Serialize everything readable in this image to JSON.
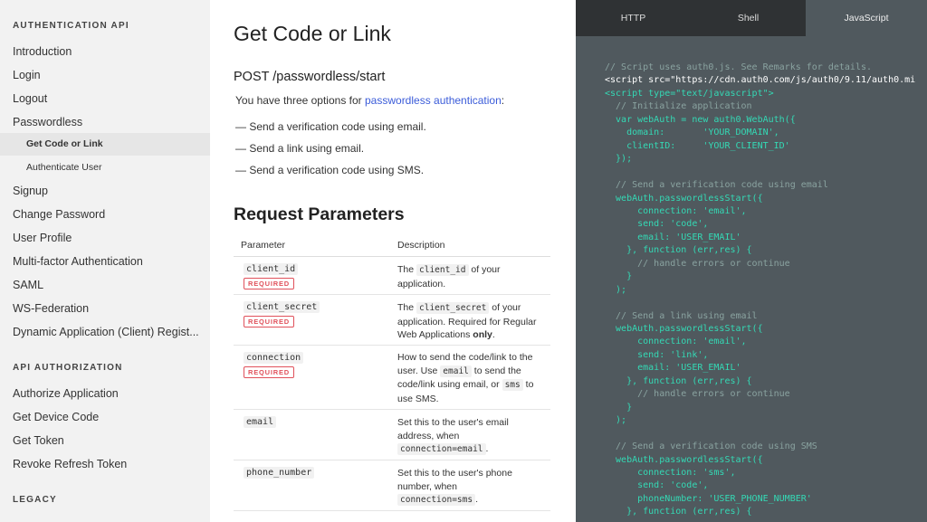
{
  "sidebar": {
    "section_auth": "AUTHENTICATION API",
    "items_auth": [
      "Introduction",
      "Login",
      "Logout",
      "Passwordless"
    ],
    "sub_items": [
      "Get Code or Link",
      "Authenticate User"
    ],
    "items_auth2": [
      "Signup",
      "Change Password",
      "User Profile",
      "Multi-factor Authentication",
      "SAML",
      "WS-Federation",
      "Dynamic Application (Client) Regist..."
    ],
    "section_authz": "API AUTHORIZATION",
    "items_authz": [
      "Authorize Application",
      "Get Device Code",
      "Get Token",
      "Revoke Refresh Token"
    ],
    "section_legacy": "LEGACY"
  },
  "main": {
    "title": "Get Code or Link",
    "endpoint": "POST /passwordless/start",
    "intro_prefix": "You have three options for ",
    "intro_link": "passwordless authentication",
    "intro_suffix": ":",
    "options": [
      "— Send a verification code using email.",
      "— Send a link using email.",
      "— Send a verification code using SMS."
    ],
    "section_title": "Request Parameters",
    "table_headers": [
      "Parameter",
      "Description"
    ],
    "required_label": "REQUIRED",
    "rows": {
      "client_id": {
        "name": "client_id",
        "d1": "The ",
        "c1": "client_id",
        "d2": " of your",
        "d3": "application."
      },
      "client_secret": {
        "name": "client_secret",
        "d1": "The ",
        "c1": "client_secret",
        "d2": " of your",
        "d3": "application. Required for Regular",
        "d4": "Web Applications ",
        "d5": "only",
        "d6": "."
      },
      "connection": {
        "name": "connection",
        "d1": "How to send the code/link to the",
        "d2": "user. Use ",
        "c1": "email",
        "d3": " to send the",
        "d4": "code/link using email, or ",
        "c2": "sms",
        "d5": " to",
        "d6": "use SMS."
      },
      "email": {
        "name": "email",
        "d1": "Set this to the user's email",
        "d2": "address, when",
        "c1": "connection=email",
        "d3": "."
      },
      "phone_number": {
        "name": "phone_number",
        "d1": "Set this to the user's phone",
        "d2": "number, when",
        "c1": "connection=sms",
        "d3": "."
      }
    }
  },
  "code_panel": {
    "tabs": [
      "HTTP",
      "Shell",
      "JavaScript"
    ],
    "active_tab": "JavaScript",
    "lines": [
      "// Script uses auth0.js. See Remarks for details.",
      "<script src=\"https://cdn.auth0.com/js/auth0/9.11/auth0.mi",
      "<script type=\"text/javascript\">",
      "  // Initialize application",
      "  var webAuth = new auth0.WebAuth({",
      "    domain:       'YOUR_DOMAIN',",
      "    clientID:     'YOUR_CLIENT_ID'",
      "  });",
      "",
      "  // Send a verification code using email",
      "  webAuth.passwordlessStart({",
      "      connection: 'email',",
      "      send: 'code',",
      "      email: 'USER_EMAIL'",
      "    }, function (err,res) {",
      "      // handle errors or continue",
      "    }",
      "  );",
      "",
      "  // Send a link using email",
      "  webAuth.passwordlessStart({",
      "      connection: 'email',",
      "      send: 'link',",
      "      email: 'USER_EMAIL'",
      "    }, function (err,res) {",
      "      // handle errors or continue",
      "    }",
      "  );",
      "",
      "  // Send a verification code using SMS",
      "  webAuth.passwordlessStart({",
      "      connection: 'sms',",
      "      send: 'code',",
      "      phoneNumber: 'USER_PHONE_NUMBER'",
      "    }, function (err,res) {"
    ]
  },
  "colors": {
    "code_bg": "#50595e",
    "tab_bar_bg": "#2f3234",
    "code_text": "#34d9b5",
    "code_comment": "#8aa3a0",
    "link": "#3b5cd9",
    "required": "#e0515b"
  }
}
